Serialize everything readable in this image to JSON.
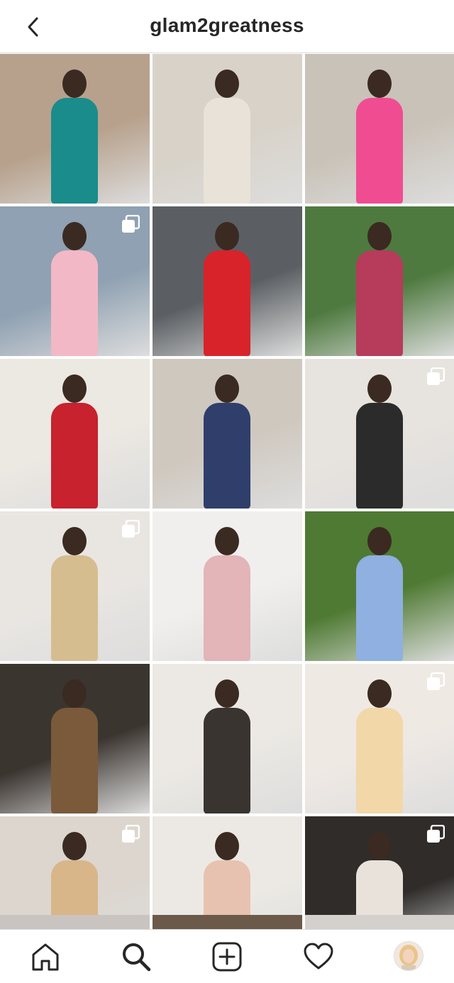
{
  "header": {
    "title": "glam2greatness",
    "back_icon": "chevron-left-icon"
  },
  "grid": {
    "tiles": [
      {
        "name": "post-polka-dot-skirt",
        "multi": false,
        "bg": "#b7a18c",
        "fg": "#1a8c8c"
      },
      {
        "name": "post-snakeskin-boots",
        "multi": false,
        "bg": "#d8d2c8",
        "fg": "#e8e2d8"
      },
      {
        "name": "post-pink-pants-steps",
        "multi": false,
        "bg": "#c9c2b8",
        "fg": "#f04c92"
      },
      {
        "name": "post-cafe-reading",
        "multi": true,
        "bg": "#8fa1b2",
        "fg": "#f2b8c6"
      },
      {
        "name": "post-red-dress-street",
        "multi": false,
        "bg": "#5b5f63",
        "fg": "#d8232a"
      },
      {
        "name": "post-plaid-outfit",
        "multi": false,
        "bg": "#4e7a3f",
        "fg": "#b73b5b"
      },
      {
        "name": "post-striped-knit-dress",
        "multi": false,
        "bg": "#ece8e2",
        "fg": "#c7222e"
      },
      {
        "name": "post-striped-blouse-chair",
        "multi": false,
        "bg": "#cfc8bf",
        "fg": "#2f3e6b"
      },
      {
        "name": "post-white-blouse-leather-pants",
        "multi": true,
        "bg": "#e7e3de",
        "fg": "#2b2b2b"
      },
      {
        "name": "post-beige-knit-dress",
        "multi": true,
        "bg": "#e9e6e2",
        "fg": "#d6bd8f"
      },
      {
        "name": "post-pink-skirt-handbag",
        "multi": false,
        "bg": "#f0efed",
        "fg": "#e3b4b8"
      },
      {
        "name": "post-blue-dress-garden",
        "multi": false,
        "bg": "#4f7a33",
        "fg": "#8fb0e0"
      },
      {
        "name": "post-monogram-clutch",
        "multi": false,
        "bg": "#3b3530",
        "fg": "#7a5a3a"
      },
      {
        "name": "post-leather-skirt-stairs",
        "multi": false,
        "bg": "#ece9e4",
        "fg": "#3a3430"
      },
      {
        "name": "post-candle-gift-box",
        "multi": true,
        "bg": "#efe9e4",
        "fg": "#f2d7a8"
      },
      {
        "name": "post-kitchen-coffee",
        "multi": true,
        "bg": "#dcd6cf",
        "fg": "#d8b68a"
      },
      {
        "name": "post-pink-blouse-wide-pants",
        "multi": false,
        "bg": "#ece9e4",
        "fg": "#e8c2b0"
      },
      {
        "name": "post-kitchen-counter",
        "multi": true,
        "bg": "#2f2c2a",
        "fg": "#e9e2da"
      }
    ]
  },
  "bottom_nav": {
    "items": [
      {
        "name": "nav-home",
        "icon": "home-icon"
      },
      {
        "name": "nav-search",
        "icon": "search-icon"
      },
      {
        "name": "nav-add",
        "icon": "add-post-icon"
      },
      {
        "name": "nav-activity",
        "icon": "heart-icon"
      },
      {
        "name": "nav-profile",
        "icon": "avatar"
      }
    ]
  }
}
